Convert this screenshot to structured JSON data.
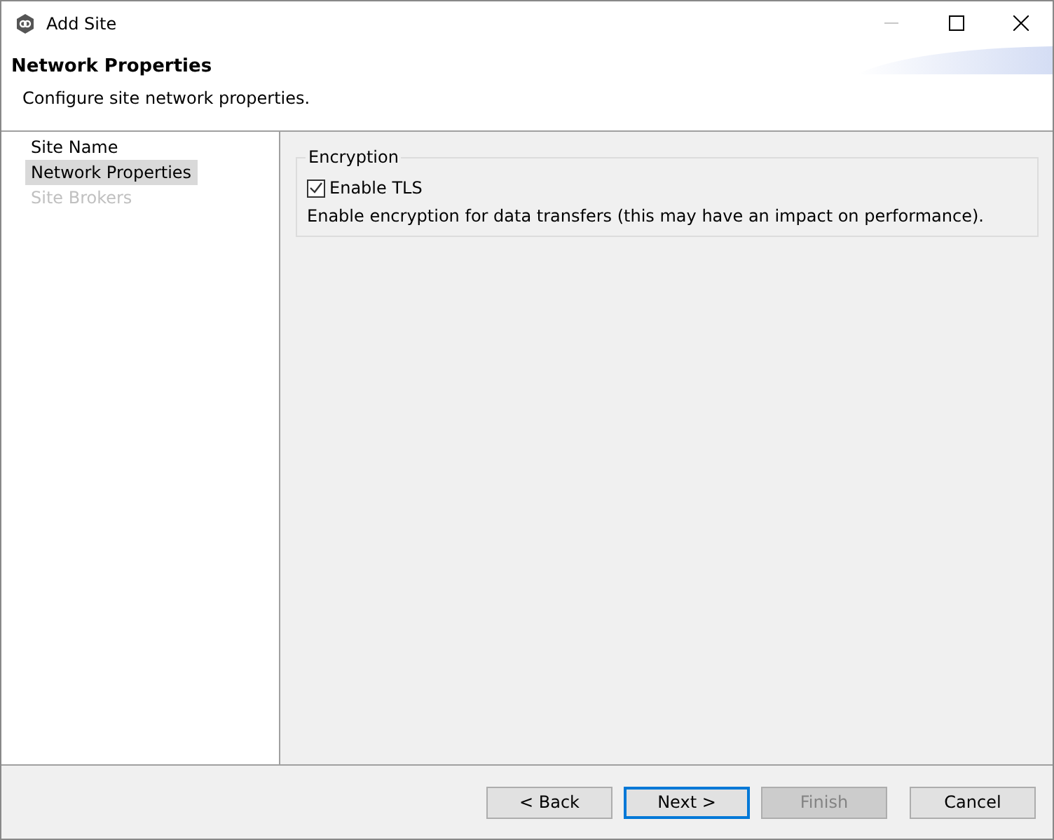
{
  "window": {
    "title": "Add Site",
    "minimize_disabled": true
  },
  "header": {
    "title": "Network Properties",
    "subtitle": "Configure site network properties."
  },
  "steps": [
    {
      "label": "Site Name",
      "selected": false,
      "disabled": false
    },
    {
      "label": "Network Properties",
      "selected": true,
      "disabled": false
    },
    {
      "label": "Site Brokers",
      "selected": false,
      "disabled": true
    }
  ],
  "group": {
    "title": "Encryption",
    "checkbox": {
      "label": "Enable TLS",
      "checked": true
    },
    "description": "Enable encryption for data transfers (this may have an impact on performance)."
  },
  "buttons": [
    {
      "label": "< Back",
      "focused": false,
      "disabled": false
    },
    {
      "label": "Next >",
      "focused": true,
      "disabled": false
    },
    {
      "label": "Finish",
      "focused": false,
      "disabled": true
    },
    {
      "label": "Cancel",
      "focused": false,
      "disabled": false
    }
  ]
}
